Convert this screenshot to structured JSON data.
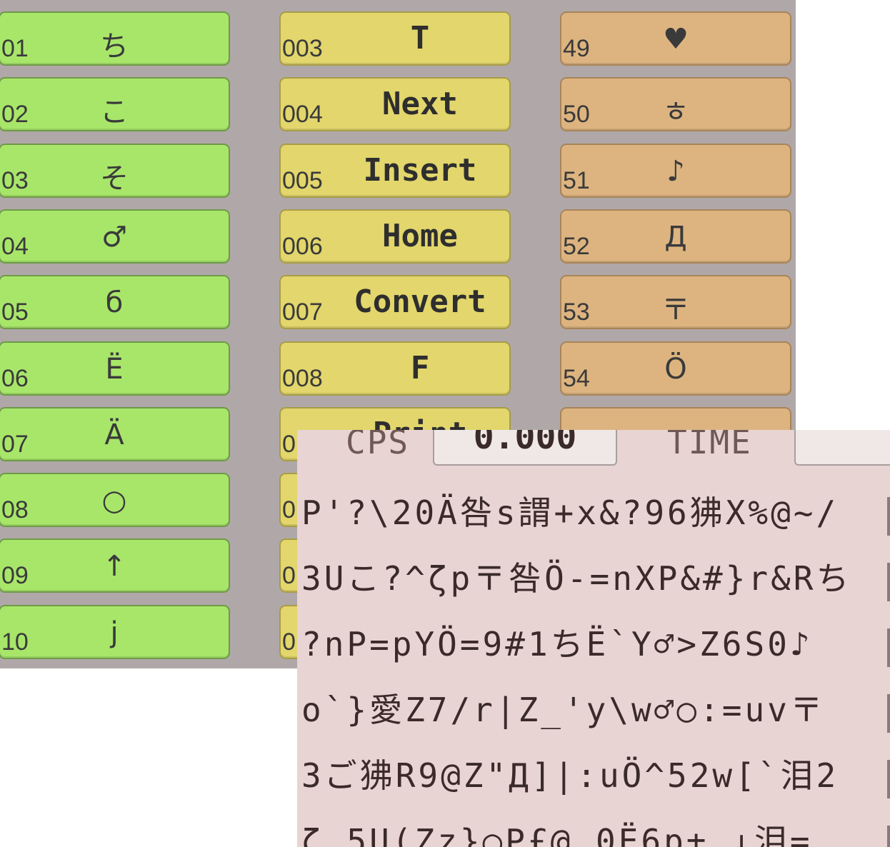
{
  "keypad": {
    "left_column": [
      {
        "num": "01",
        "char": "ち"
      },
      {
        "num": "02",
        "char": "こ"
      },
      {
        "num": "03",
        "char": "そ"
      },
      {
        "num": "04",
        "char": "♂"
      },
      {
        "num": "05",
        "char": "б"
      },
      {
        "num": "06",
        "char": "Ë"
      },
      {
        "num": "07",
        "char": "Ä"
      },
      {
        "num": "08",
        "char": "○"
      },
      {
        "num": "09",
        "char": "↑"
      },
      {
        "num": "10",
        "char": "j"
      }
    ],
    "middle_column": [
      {
        "num": "003",
        "char": "T"
      },
      {
        "num": "004",
        "char": "Next"
      },
      {
        "num": "005",
        "char": "Insert"
      },
      {
        "num": "006",
        "char": "Home"
      },
      {
        "num": "007",
        "char": "Convert"
      },
      {
        "num": "008",
        "char": "F"
      },
      {
        "num": "0",
        "char": "Print"
      },
      {
        "num": "0",
        "char": ""
      },
      {
        "num": "0",
        "char": ""
      },
      {
        "num": "0",
        "char": ""
      }
    ],
    "right_column": [
      {
        "num": "49",
        "char": "♥"
      },
      {
        "num": "50",
        "char": "ㅎ"
      },
      {
        "num": "51",
        "char": "♪"
      },
      {
        "num": "52",
        "char": "Д"
      },
      {
        "num": "53",
        "char": "〒"
      },
      {
        "num": "54",
        "char": "Ö"
      },
      {
        "num": "",
        "char": "〒"
      }
    ],
    "colors": {
      "green": "#a8e66a",
      "yellow": "#e2d66c",
      "orange": "#ddb480",
      "background": "#b0a8a8"
    }
  },
  "panel": {
    "cps_label": "CPS",
    "cps_value": "0.000",
    "time_label": "TIME",
    "stream_lines": [
      "P'?\\20Ä咎s謂+x&?96狒X%@~/",
      "3Uこ?^ζp〒咎Ö-=nXP&#}r&Rち",
      "?nP=pYÖ=9#1ちË`Y♂>Z6S0♪",
      "o`}愛Z7/r|Z_'y\\w♂○:=uv〒",
      "3ご狒R9@Z\"Д]|:uÖ^52w[`泪2",
      "ζ.5U(Zz}○P£@,0Ë6p±,↓泪="
    ],
    "background": "#e8d4d2"
  }
}
